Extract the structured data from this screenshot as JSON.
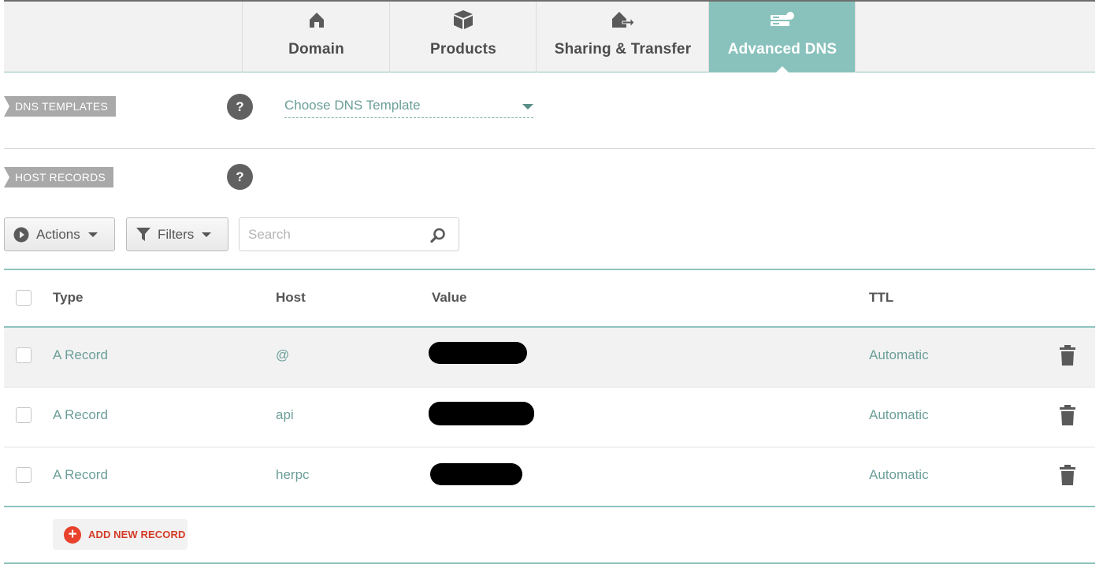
{
  "tabs": [
    {
      "label": "Domain",
      "icon": "home-icon",
      "active": false
    },
    {
      "label": "Products",
      "icon": "box-icon",
      "active": false
    },
    {
      "label": "Sharing & Transfer",
      "icon": "house-transfer-icon",
      "active": false
    },
    {
      "label": "Advanced DNS",
      "icon": "server-icon",
      "active": true
    }
  ],
  "dns_templates": {
    "label": "DNS TEMPLATES",
    "help": "?",
    "select_value": "Choose DNS Template"
  },
  "host_records": {
    "label": "HOST RECORDS",
    "help": "?"
  },
  "toolbar": {
    "actions_label": "Actions",
    "filters_label": "Filters",
    "search_placeholder": "Search"
  },
  "table": {
    "headers": {
      "type": "Type",
      "host": "Host",
      "value": "Value",
      "ttl": "TTL"
    },
    "rows": [
      {
        "type": "A Record",
        "host": "@",
        "ttl": "Automatic"
      },
      {
        "type": "A Record",
        "host": "api",
        "ttl": "Automatic"
      },
      {
        "type": "A Record",
        "host": "herpc",
        "ttl": "Automatic"
      }
    ]
  },
  "add_record_label": "ADD NEW RECORD",
  "colors": {
    "accent_teal": "#89c2bc",
    "link_teal": "#6b9e98",
    "add_red": "#e8412c"
  }
}
